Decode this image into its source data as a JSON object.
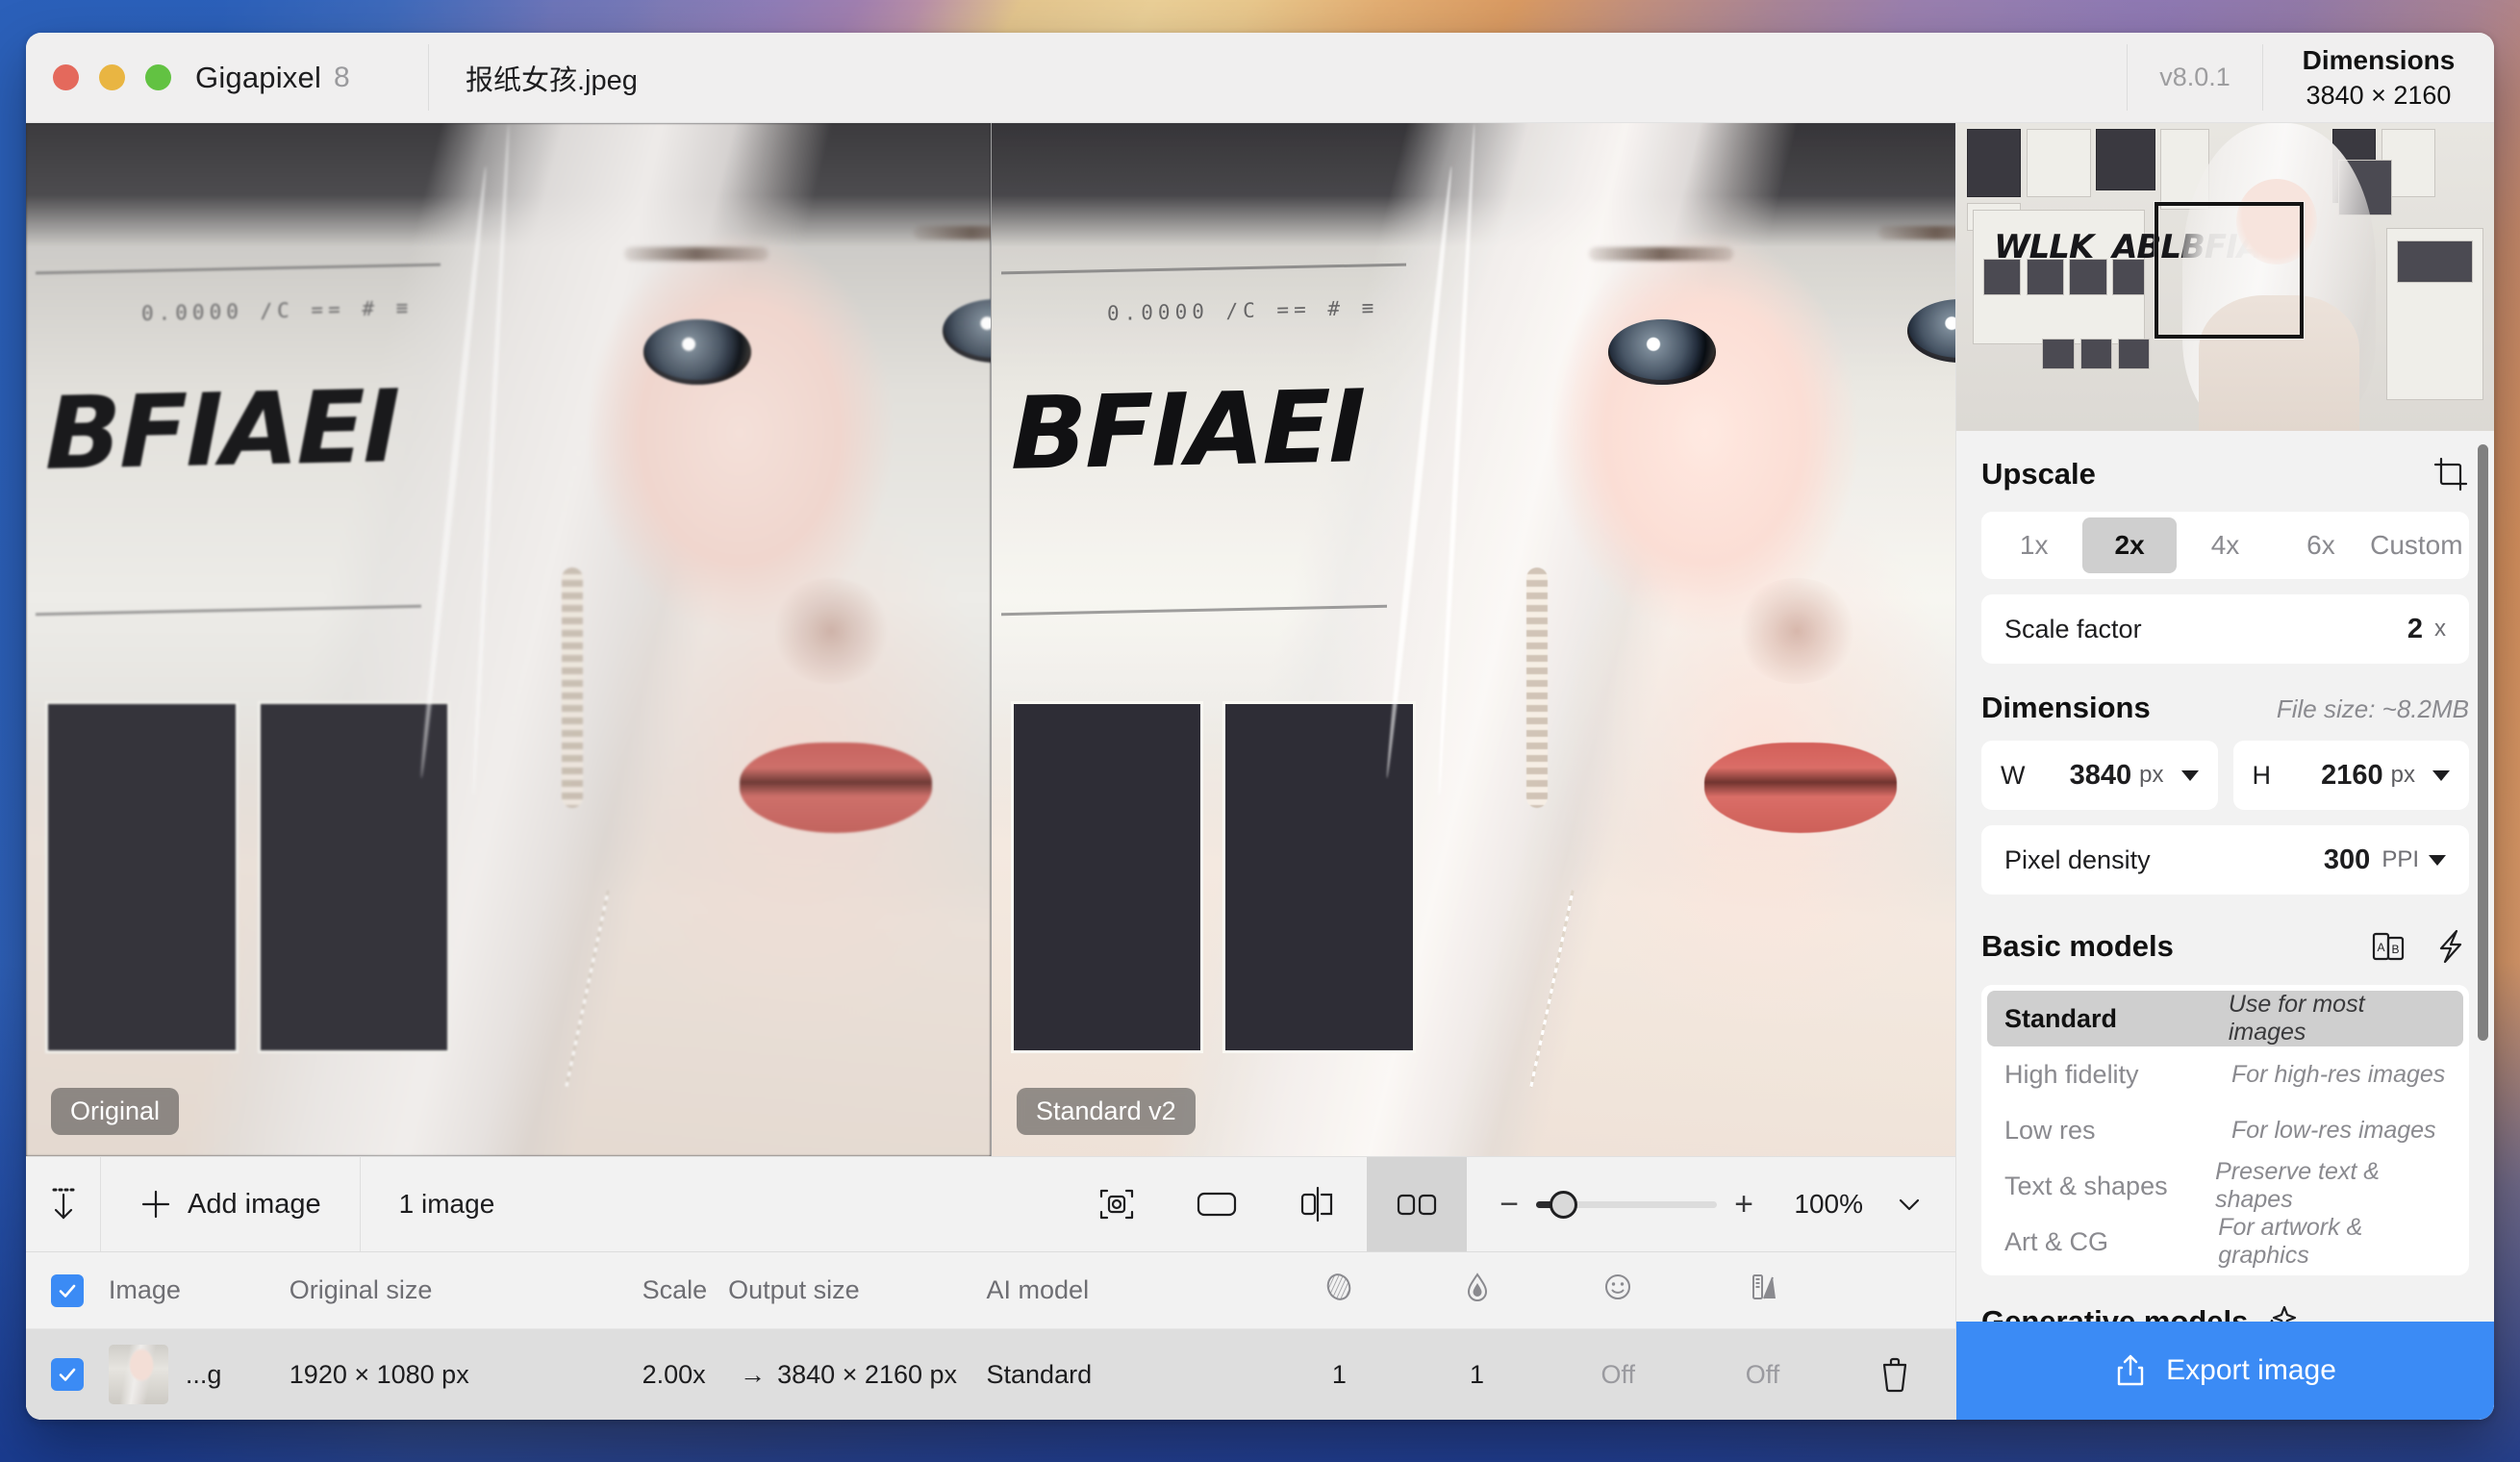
{
  "app": {
    "name": "Gigapixel",
    "major_version": "8",
    "version_label": "v8.0.1",
    "file_name": "报纸女孩.jpeg",
    "dimensions_label": "Dimensions",
    "dimensions_value": "3840 × 2160"
  },
  "canvas": {
    "left_label": "Original",
    "right_label": "Standard v2",
    "headline_text": "BFIAEI",
    "headline_sub": "0.0000 /C  ==  # ≡"
  },
  "navigator": {
    "headline_left": "WLLK",
    "headline_right": "ABLBFIAEI"
  },
  "toolbar": {
    "sort_icon": "sort-descending-icon",
    "add_image_label": "Add image",
    "add_icon": "plus-icon",
    "image_count_label": "1 image",
    "view_modes": [
      {
        "name": "view-mode-focus",
        "icon": "focus-frame-icon",
        "active": false
      },
      {
        "name": "view-mode-single",
        "icon": "single-pane-icon",
        "active": false
      },
      {
        "name": "view-mode-split",
        "icon": "split-slider-icon",
        "active": false
      },
      {
        "name": "view-mode-side-by-side",
        "icon": "side-by-side-icon",
        "active": true
      }
    ],
    "zoom_minus": "−",
    "zoom_plus": "+",
    "zoom_value": "100%",
    "zoom_caret": "chevron-down-icon"
  },
  "table": {
    "headers": {
      "image": "Image",
      "original_size": "Original size",
      "scale": "Scale",
      "output_size": "Output size",
      "ai_model": "AI model",
      "icon_columns": [
        "denoise-icon",
        "sharpen-icon",
        "face-recovery-icon",
        "color-icon"
      ]
    },
    "rows": [
      {
        "checked": true,
        "file_name": "...g",
        "original_size": "1920 × 1080 px",
        "scale": "2.00x",
        "arrow": "→",
        "output_size": "3840 × 2160 px",
        "ai_model": "Standard",
        "denoise": "1",
        "sharpen": "1",
        "face_recovery": "Off",
        "color": "Off",
        "delete_icon": "trash-icon"
      }
    ]
  },
  "upscale": {
    "title": "Upscale",
    "crop_icon": "crop-icon",
    "presets": [
      "1x",
      "2x",
      "4x",
      "6x",
      "Custom"
    ],
    "active_preset": "2x",
    "scale_factor_label": "Scale factor",
    "scale_factor_value": "2",
    "scale_factor_unit": "x"
  },
  "dimensions": {
    "title": "Dimensions",
    "file_size": "File size: ~8.2MB",
    "width_label": "W",
    "width_value": "3840",
    "width_unit": "px",
    "height_label": "H",
    "height_value": "2160",
    "height_unit": "px",
    "pixel_density_label": "Pixel density",
    "pixel_density_value": "300",
    "pixel_density_unit": "PPI"
  },
  "basic_models": {
    "title": "Basic models",
    "compare_icon": "ab-compare-icon",
    "bolt_icon": "lightning-icon",
    "items": [
      {
        "name": "Standard",
        "desc": "Use for most images",
        "active": true
      },
      {
        "name": "High fidelity",
        "desc": "For high-res images",
        "active": false
      },
      {
        "name": "Low res",
        "desc": "For low-res images",
        "active": false
      },
      {
        "name": "Text & shapes",
        "desc": "Preserve text & shapes",
        "active": false
      },
      {
        "name": "Art & CG",
        "desc": "For artwork & graphics",
        "active": false
      }
    ]
  },
  "generative_models": {
    "title": "Generative models",
    "sparkle_icon": "sparkles-icon"
  },
  "export": {
    "label": "Export image",
    "icon": "share-upload-icon"
  },
  "colors": {
    "accent": "#3b8bf5",
    "panel_bg": "#f2f2f2",
    "row_selected": "#dedede",
    "segment_active": "#cfcfcf"
  }
}
